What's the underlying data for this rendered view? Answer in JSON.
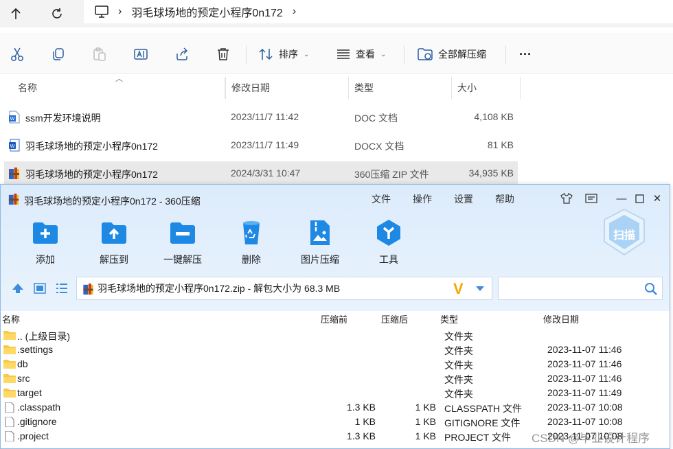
{
  "explorer": {
    "breadcrumb": {
      "folder": "羽毛球场地的预定小程序0n172"
    },
    "toolbar": {
      "icons": [
        "cut-icon",
        "copy-icon",
        "paste-icon",
        "rename-icon",
        "share-icon",
        "delete-icon"
      ],
      "sort_label": "排序",
      "view_label": "查看",
      "extract_all_label": "全部解压缩",
      "more_label": "···"
    },
    "columns": {
      "name": "名称",
      "date": "修改日期",
      "type": "类型",
      "size": "大小"
    },
    "files": [
      {
        "name": "ssm开发环境说明",
        "date": "2023/11/7 11:42",
        "type": "DOC 文档",
        "size": "4,108 KB",
        "icon": "word-doc-icon"
      },
      {
        "name": "羽毛球场地的预定小程序0n172",
        "date": "2023/11/7 11:49",
        "type": "DOCX 文档",
        "size": "81 KB",
        "icon": "word-docx-icon"
      },
      {
        "name": "羽毛球场地的预定小程序0n172",
        "date": "2024/3/31 10:47",
        "type": "360压缩 ZIP 文件",
        "size": "34,935 KB",
        "icon": "zip-archive-icon"
      }
    ]
  },
  "zip": {
    "title": "羽毛球场地的预定小程序0n172 - 360压缩",
    "menu": [
      "文件",
      "操作",
      "设置",
      "帮助"
    ],
    "tools": [
      "添加",
      "解压到",
      "一键解压",
      "删除",
      "图片压缩",
      "工具"
    ],
    "scan_label": "扫描",
    "path": "羽毛球场地的预定小程序0n172.zip - 解包大小为 68.3 MB",
    "columns": {
      "name": "名称",
      "before": "压缩前",
      "after": "压缩后",
      "type": "类型",
      "date": "修改日期"
    },
    "rows": [
      {
        "name": ".. (上级目录)",
        "before": "",
        "after": "",
        "type": "文件夹",
        "date": "",
        "kind": "folder"
      },
      {
        "name": ".settings",
        "before": "",
        "after": "",
        "type": "文件夹",
        "date": "2023-11-07 11:46",
        "kind": "folder"
      },
      {
        "name": "db",
        "before": "",
        "after": "",
        "type": "文件夹",
        "date": "2023-11-07 11:46",
        "kind": "folder"
      },
      {
        "name": "src",
        "before": "",
        "after": "",
        "type": "文件夹",
        "date": "2023-11-07 11:46",
        "kind": "folder"
      },
      {
        "name": "target",
        "before": "",
        "after": "",
        "type": "文件夹",
        "date": "2023-11-07 11:49",
        "kind": "folder"
      },
      {
        "name": ".classpath",
        "before": "1.3 KB",
        "after": "1 KB",
        "type": "CLASSPATH 文件",
        "date": "2023-11-07 10:08",
        "kind": "file"
      },
      {
        "name": ".gitignore",
        "before": "1 KB",
        "after": "1 KB",
        "type": "GITIGNORE 文件",
        "date": "2023-11-07 10:08",
        "kind": "file"
      },
      {
        "name": ".project",
        "before": "1.3 KB",
        "after": "1 KB",
        "type": "PROJECT 文件",
        "date": "2023-11-07 10:08",
        "kind": "file"
      }
    ]
  },
  "watermark": "CSDN @毕业设计程序"
}
